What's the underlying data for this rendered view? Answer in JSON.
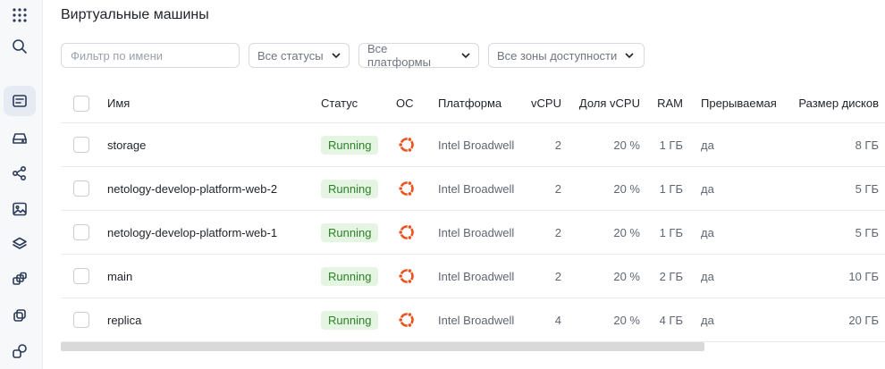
{
  "sidebar": {
    "items": [
      {
        "icon": "apps-grid-icon"
      },
      {
        "icon": "search-icon"
      },
      {
        "icon": "compute-list-icon",
        "active": true
      },
      {
        "icon": "disk-icon"
      },
      {
        "icon": "network-icon"
      },
      {
        "icon": "image-icon"
      },
      {
        "icon": "layers-icon"
      },
      {
        "icon": "instance-groups-icon"
      },
      {
        "icon": "snapshots-icon"
      },
      {
        "icon": "placement-groups-icon"
      }
    ]
  },
  "page": {
    "title": "Виртуальные машины"
  },
  "filters": {
    "name_placeholder": "Фильтр по имени",
    "status": "Все статусы",
    "platform": "Все платформы",
    "zone": "Все зоны доступности"
  },
  "table": {
    "columns": {
      "name": "Имя",
      "status": "Статус",
      "os": "ОС",
      "platform": "Платформа",
      "vcpu": "vCPU",
      "share": "Доля vCPU",
      "ram": "RAM",
      "preemptible": "Прерываемая",
      "disk": "Размер дисков"
    },
    "rows": [
      {
        "name": "storage",
        "status": "Running",
        "os": "ubuntu",
        "platform": "Intel Broadwell",
        "vcpu": "2",
        "share": "20 %",
        "ram": "1 ГБ",
        "preemptible": "да",
        "disk": "8 ГБ"
      },
      {
        "name": "netology-develop-platform-web-2",
        "status": "Running",
        "os": "ubuntu",
        "platform": "Intel Broadwell",
        "vcpu": "2",
        "share": "20 %",
        "ram": "1 ГБ",
        "preemptible": "да",
        "disk": "5 ГБ"
      },
      {
        "name": "netology-develop-platform-web-1",
        "status": "Running",
        "os": "ubuntu",
        "platform": "Intel Broadwell",
        "vcpu": "2",
        "share": "20 %",
        "ram": "1 ГБ",
        "preemptible": "да",
        "disk": "5 ГБ"
      },
      {
        "name": "main",
        "status": "Running",
        "os": "ubuntu",
        "platform": "Intel Broadwell",
        "vcpu": "2",
        "share": "20 %",
        "ram": "2 ГБ",
        "preemptible": "да",
        "disk": "10 ГБ"
      },
      {
        "name": "replica",
        "status": "Running",
        "os": "ubuntu",
        "platform": "Intel Broadwell",
        "vcpu": "4",
        "share": "20 %",
        "ram": "4 ГБ",
        "preemptible": "да",
        "disk": "20 ГБ"
      }
    ]
  },
  "colors": {
    "running_bg": "#e4f5e1",
    "running_text": "#2f7f2a",
    "ubuntu_orange": "#e95420",
    "sidebar_active": "#e6ebf3"
  }
}
